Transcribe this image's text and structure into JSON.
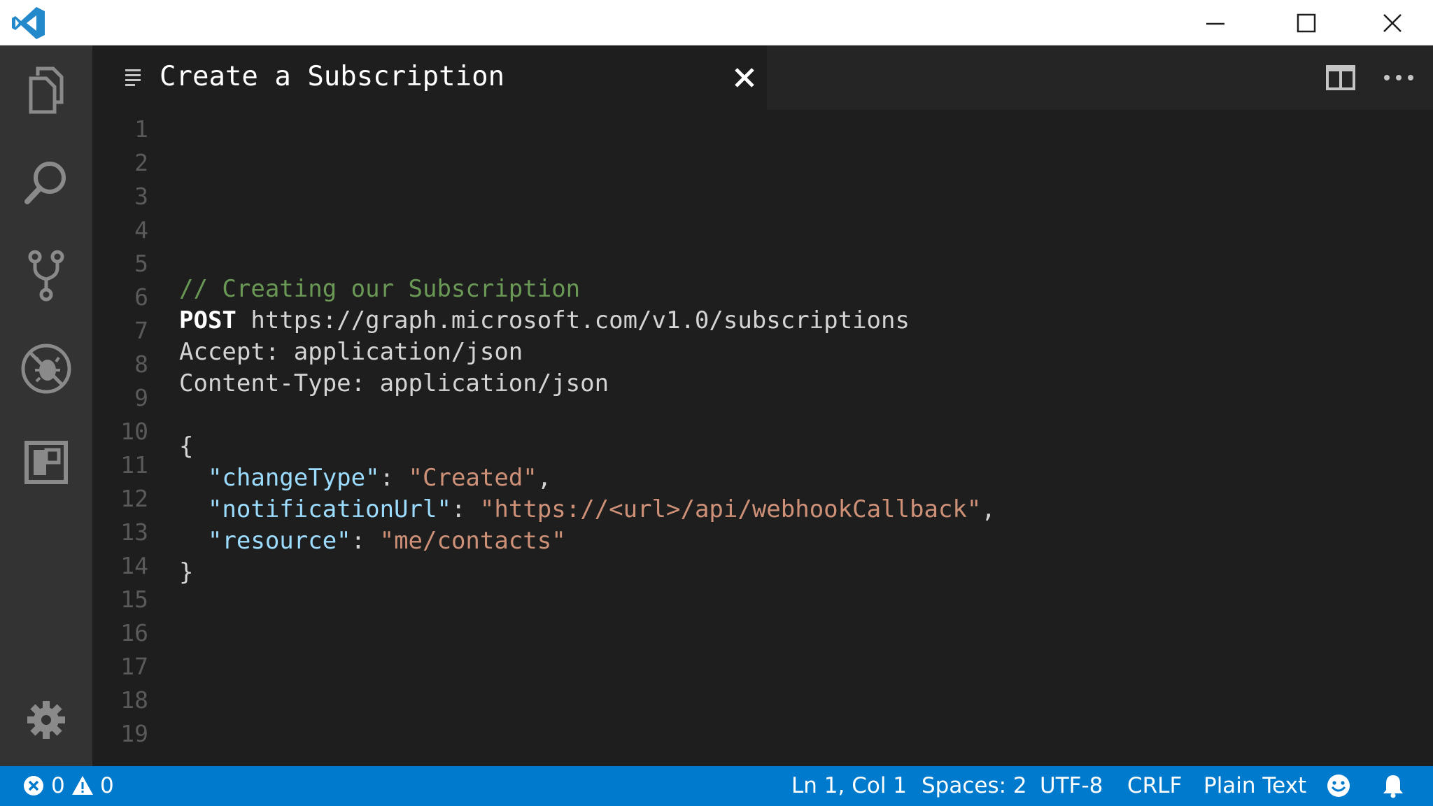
{
  "window": {
    "app_icon": "vscode-logo-icon",
    "controls": [
      "minimize-icon",
      "maximize-icon",
      "close-icon"
    ]
  },
  "activity_bar": {
    "items": [
      "explorer-icon",
      "search-icon",
      "source-control-icon",
      "debug-icon",
      "extensions-icon"
    ],
    "bottom": "gear-icon"
  },
  "tab": {
    "title": "Create a Subscription",
    "file_icon": "text-file-icon",
    "close_icon": "close-icon"
  },
  "editor_actions": [
    "split-editor-icon",
    "more-actions-icon"
  ],
  "editor": {
    "line_numbers": [
      "1",
      "2",
      "3",
      "4",
      "5",
      "6",
      "7",
      "8",
      "9",
      "10",
      "11",
      "12",
      "13",
      "14",
      "15",
      "16",
      "17",
      "18",
      "19"
    ],
    "code": {
      "comment": "// Creating our Subscription",
      "method": "POST",
      "url": " https://graph.microsoft.com/v1.0/subscriptions",
      "accept": "Accept: application/json",
      "content_type": "Content-Type: application/json",
      "open_brace": "{",
      "indent": "  ",
      "k1": "\"changeType\"",
      "v1": "\"Created\"",
      "k2": "\"notificationUrl\"",
      "v2": "\"https://<url>/api/webhookCallback\"",
      "k3": "\"resource\"",
      "v3": "\"me/contacts\"",
      "colon": ": ",
      "comma": ",",
      "close_brace": "}"
    }
  },
  "status_bar": {
    "errors": "0",
    "warnings": "0",
    "position": "Ln 1, Col 1",
    "spaces": "Spaces: 2",
    "encoding": "UTF-8",
    "eol": "CRLF",
    "language": "Plain Text",
    "feedback_icon": "smiley-icon",
    "notifications_icon": "bell-icon"
  },
  "colors": {
    "status_bar": "#007acc",
    "activity_bar": "#333333",
    "editor_bg": "#1e1e1e",
    "comment": "#6a9955",
    "json_key": "#9cdcfe",
    "json_string": "#ce9178"
  }
}
